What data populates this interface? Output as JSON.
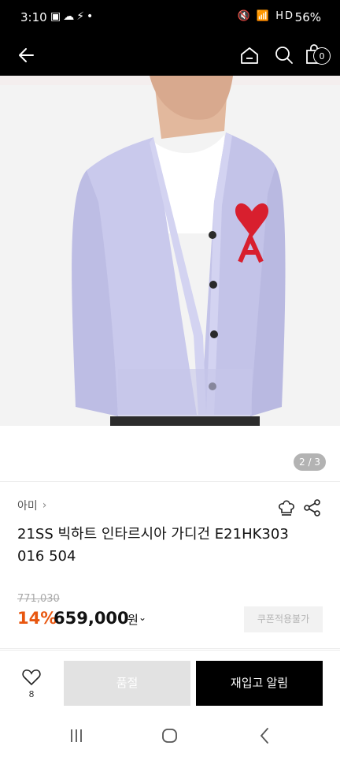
{
  "status_bar": {
    "time": "3:10",
    "left_icons": "▣☁⚡•",
    "right_icons": "🔇 📶 HD",
    "battery": "56%"
  },
  "header": {
    "back_icon": "back-arrow-icon",
    "home_icon": "home-icon",
    "search_icon": "search-icon",
    "cart_icon": "cart-icon",
    "cart_count": "0"
  },
  "gallery": {
    "counter": "2 / 3"
  },
  "product": {
    "brand": "아미",
    "title": "21SS 빅하트 인타르시아 가디건 E21HK303 016 504",
    "original_price": "771,030",
    "discount": "14%",
    "sale_price": "659,000",
    "currency": "원"
  },
  "actions": {
    "coupon_label": "쿠폰적용불가",
    "wish_count": "8",
    "soldout_label": "품절",
    "restock_label": "재입고 알림"
  },
  "colors": {
    "discount": "#e8560f",
    "button_primary": "#000000",
    "button_disabled": "#e2e2e2"
  }
}
